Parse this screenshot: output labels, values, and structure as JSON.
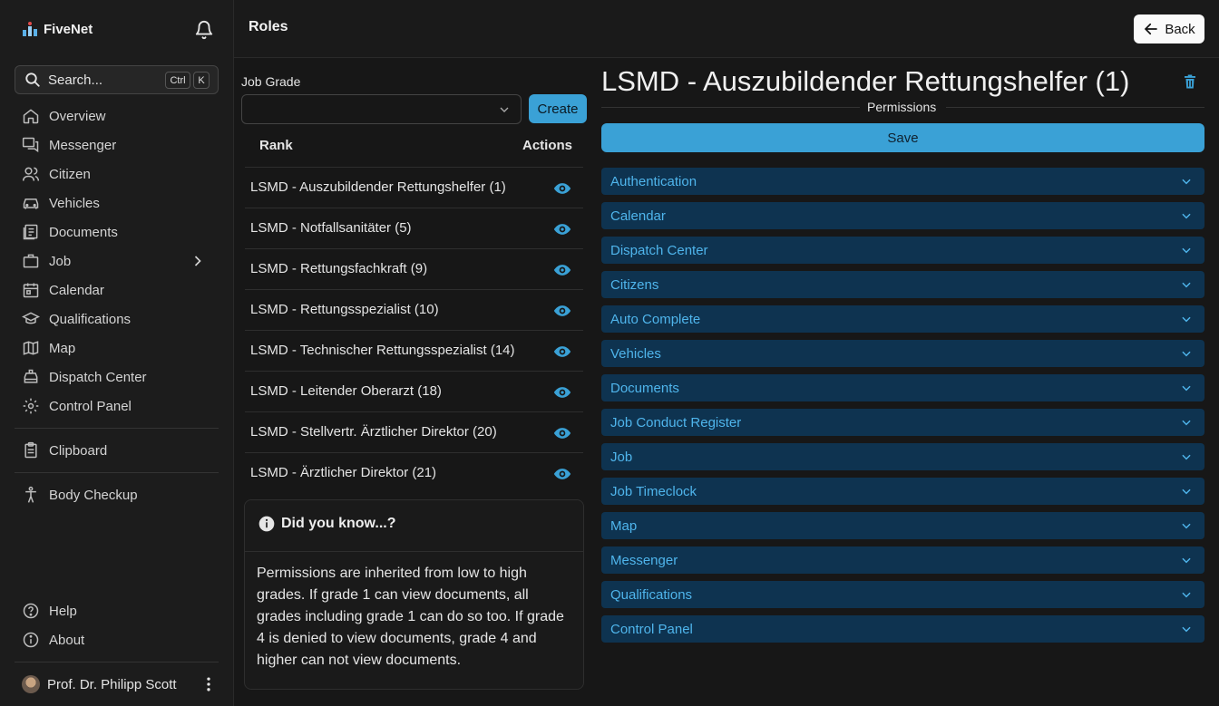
{
  "app": {
    "name": "FiveNet"
  },
  "search": {
    "label": "Search...",
    "key1": "Ctrl",
    "key2": "K"
  },
  "nav": {
    "overview": "Overview",
    "messenger": "Messenger",
    "citizen": "Citizen",
    "vehicles": "Vehicles",
    "documents": "Documents",
    "job": "Job",
    "calendar": "Calendar",
    "qualifications": "Qualifications",
    "map": "Map",
    "dispatch": "Dispatch Center",
    "control": "Control Panel",
    "clipboard": "Clipboard",
    "body": "Body Checkup",
    "help": "Help",
    "about": "About"
  },
  "user": {
    "name": "Prof. Dr. Philipp Scott"
  },
  "header": {
    "title": "Roles",
    "back": "Back"
  },
  "job_grade": {
    "label": "Job Grade",
    "value": "",
    "create": "Create"
  },
  "table": {
    "col_rank": "Rank",
    "col_actions": "Actions",
    "rows": [
      "LSMD - Auszubildender Rettungshelfer (1)",
      "LSMD - Notfallsanitäter (5)",
      "LSMD - Rettungsfachkraft (9)",
      "LSMD - Rettungsspezialist (10)",
      "LSMD - Technischer Rettungsspezialist (14)",
      "LSMD - Leitender Oberarzt (18)",
      "LSMD - Stellvertr. Ärztlicher Direktor (20)",
      "LSMD - Ärztlicher Direktor (21)"
    ]
  },
  "tip": {
    "title": "Did you know...?",
    "body": "Permissions are inherited from low to high grades. If grade 1 can view documents, all grades including grade 1 can do so too. If grade 4 is denied to view documents, grade 4 and higher can not view documents."
  },
  "role": {
    "title": "LSMD - Auszubildender Rettungshelfer (1)",
    "permissions_label": "Permissions",
    "save": "Save",
    "sections": [
      "Authentication",
      "Calendar",
      "Dispatch Center",
      "Citizens",
      "Auto Complete",
      "Vehicles",
      "Documents",
      "Job Conduct Register",
      "Job",
      "Job Timeclock",
      "Map",
      "Messenger",
      "Qualifications",
      "Control Panel"
    ]
  },
  "colors": {
    "accent": "#3aa1d6",
    "accordion_bg": "#0e3350",
    "accordion_text": "#4fb5ec",
    "background": "#171717"
  }
}
